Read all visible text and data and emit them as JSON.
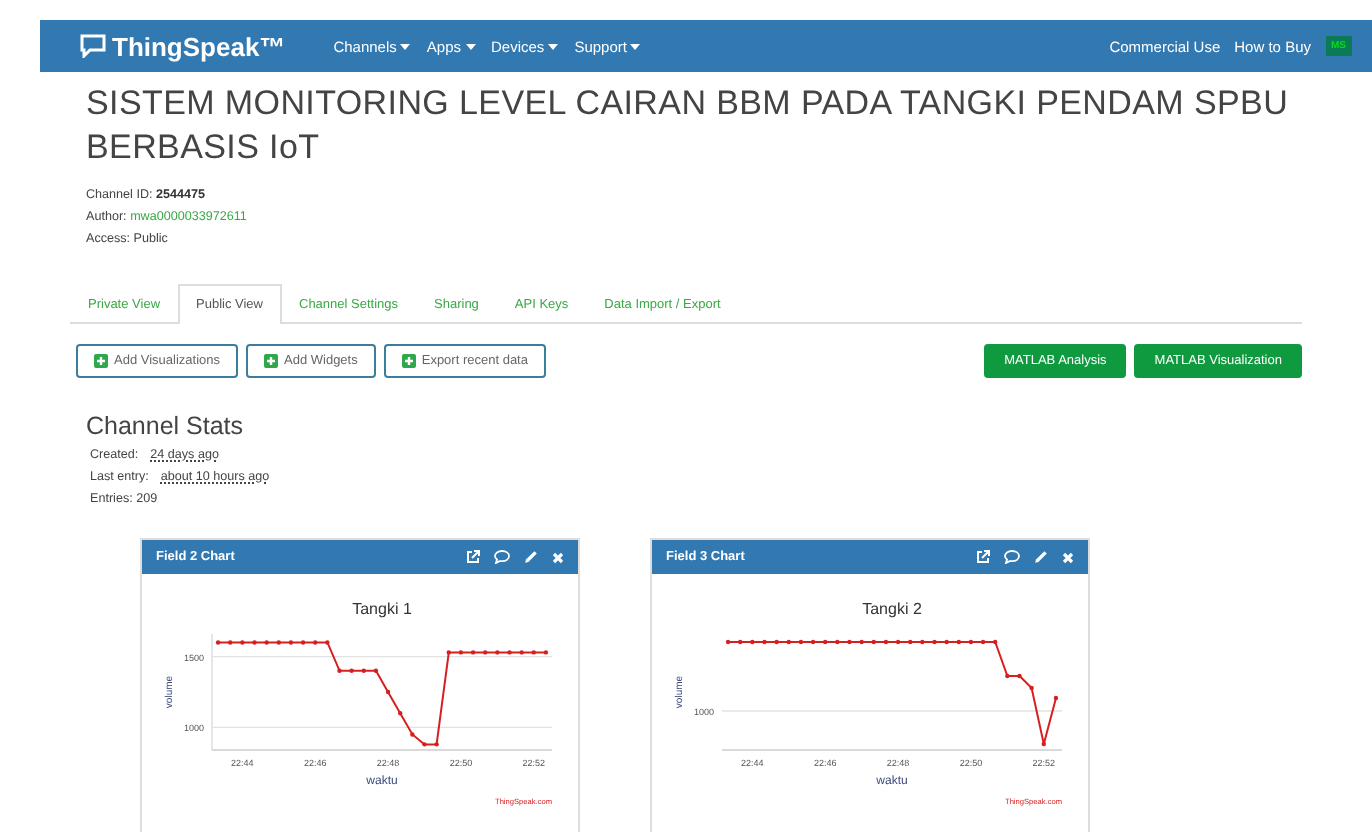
{
  "navbar": {
    "logo": "ThingSpeak™",
    "menus": [
      {
        "label": "Channels"
      },
      {
        "label": "Apps"
      },
      {
        "label": "Devices"
      },
      {
        "label": "Support"
      }
    ],
    "links": [
      "Commercial Use",
      "How to Buy"
    ],
    "avatar": "MS"
  },
  "title": "SISTEM MONITORING LEVEL CAIRAN BBM PADA TANGKI PENDAM SPBU BERBASIS IoT",
  "info": {
    "channel_id_label": "Channel ID:",
    "channel_id": "2544475",
    "author_label": "Author:",
    "author": "mwa0000033972611",
    "access": "Access: Public"
  },
  "tabs": [
    {
      "label": "Private View",
      "selected": false
    },
    {
      "label": "Public View",
      "selected": true
    },
    {
      "label": "Channel Settings",
      "selected": false
    },
    {
      "label": "Sharing",
      "selected": false
    },
    {
      "label": "API Keys",
      "selected": false
    },
    {
      "label": "Data Import / Export",
      "selected": false
    }
  ],
  "actions": [
    {
      "label": "Add Visualizations",
      "kind": "outline"
    },
    {
      "label": "Add Widgets",
      "kind": "outline"
    },
    {
      "label": "Export recent data",
      "kind": "outline"
    },
    {
      "label": "MATLAB Analysis",
      "kind": "solid"
    },
    {
      "label": "MATLAB Visualization",
      "kind": "solid"
    }
  ],
  "stats": {
    "heading": "Channel Stats",
    "created_label": "Created:",
    "created": "24 days ago",
    "last_label": "Last entry:",
    "last": "about 10 hours ago",
    "entries": "Entries: 209"
  },
  "cards": [
    {
      "kind": "chart",
      "header": "Field 2 Chart",
      "credit": "ThingSpeak.com",
      "chart_data": {
        "type": "line",
        "title": "Tangki 1",
        "xlabel": "waktu",
        "ylabel": "volume",
        "ylim": [
          840,
          1660
        ],
        "yticks": [
          1000,
          1500
        ],
        "categories": [
          null,
          null,
          "22:44",
          null,
          null,
          null,
          null,
          null,
          "22:46",
          null,
          null,
          null,
          null,
          null,
          "22:48",
          null,
          null,
          null,
          null,
          null,
          "22:50",
          null,
          null,
          null,
          null,
          null,
          "22:52",
          null
        ],
        "series": [
          {
            "color": "#d62020",
            "values": [
              1600,
              1600,
              1600,
              1600,
              1600,
              1600,
              1600,
              1600,
              1600,
              1600,
              1400,
              1400,
              1400,
              1400,
              1250,
              1100,
              950,
              880,
              880,
              1530,
              1530,
              1530,
              1530,
              1530,
              1530,
              1530,
              1530,
              1530
            ]
          }
        ]
      }
    },
    {
      "kind": "picture",
      "header": "Field 3 Chart",
      "credit": "ThingSpeak.com",
      "chart": {
        "title": "Tangki 2",
        "xlabel": "waktu",
        "ylabel": "volume",
        "y_label": "1000",
        "x_labels": [
          "22:44",
          "22:46",
          "22:48",
          "22:50",
          "22:52"
        ]
      }
    }
  ]
}
